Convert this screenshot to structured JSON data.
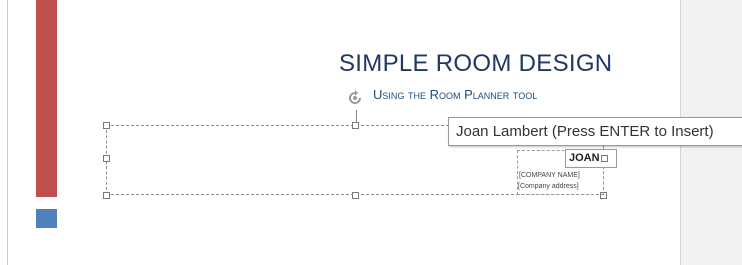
{
  "colors": {
    "accent_red": "#c0504d",
    "accent_blue": "#4f81bd",
    "title_text": "#1f3864",
    "subtitle_text": "#1f4e79"
  },
  "document": {
    "title": "SIMPLE ROOM DESIGN",
    "subtitle": "Using the Room Planner tool",
    "author_field": "JOAN",
    "company_name": "[COMPANY NAME]",
    "company_address": "[Company address]"
  },
  "icons": {
    "rotate": "rotate-handle-icon"
  },
  "tooltip": {
    "text": "Joan Lambert  (Press ENTER to Insert)"
  }
}
